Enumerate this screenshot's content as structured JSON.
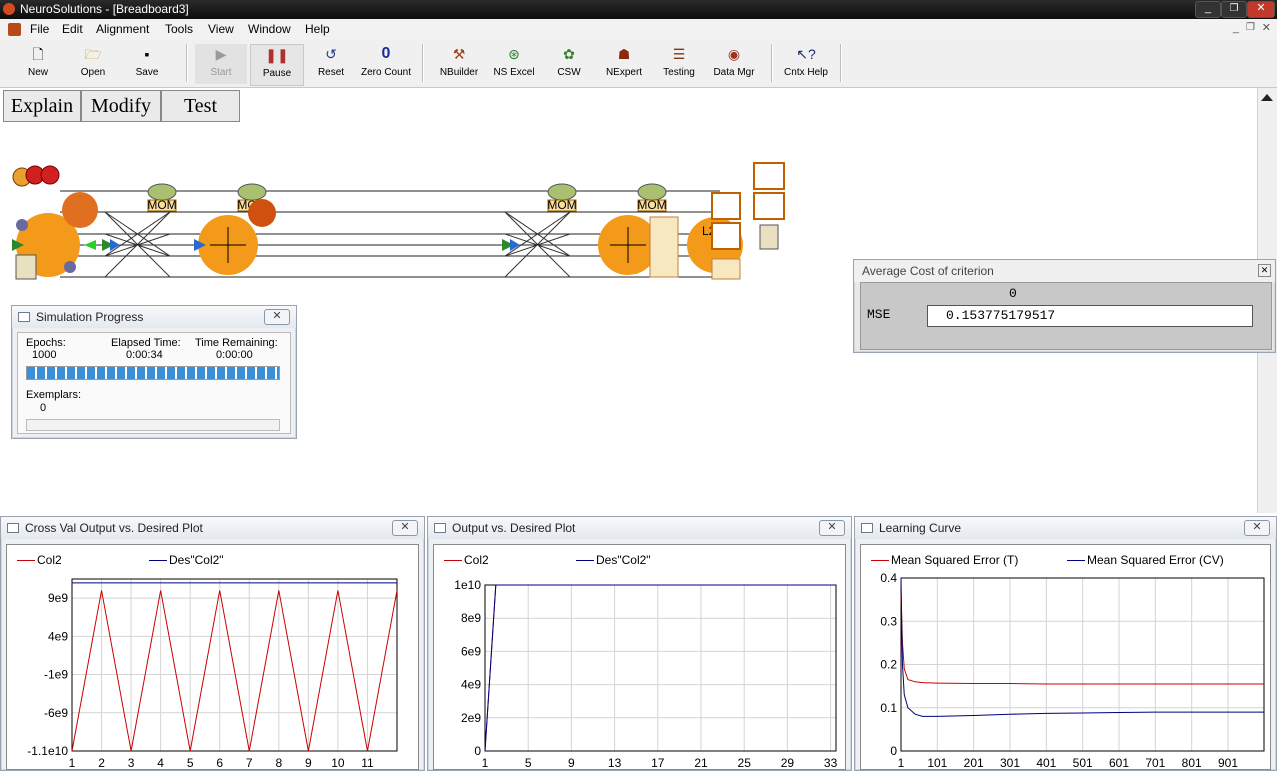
{
  "app": {
    "title": "NeuroSolutions - [Breadboard3]"
  },
  "menu": [
    "File",
    "Edit",
    "Alignment",
    "Tools",
    "View",
    "Window",
    "Help"
  ],
  "toolbar": [
    {
      "label": "New",
      "icon": "new-file-icon"
    },
    {
      "label": "Open",
      "icon": "open-folder-icon"
    },
    {
      "label": "Save",
      "icon": "save-disk-icon"
    },
    {
      "label": "Start",
      "icon": "play-icon"
    },
    {
      "label": "Pause",
      "icon": "pause-icon"
    },
    {
      "label": "Reset",
      "icon": "reset-icon"
    },
    {
      "label": "Zero Count",
      "icon": "zero-icon",
      "glyph": "0"
    },
    {
      "label": "NBuilder",
      "icon": "nbuilder-icon"
    },
    {
      "label": "NS Excel",
      "icon": "excel-icon"
    },
    {
      "label": "CSW",
      "icon": "csw-icon"
    },
    {
      "label": "NExpert",
      "icon": "nexpert-icon"
    },
    {
      "label": "Testing",
      "icon": "testing-icon"
    },
    {
      "label": "Data Mgr",
      "icon": "data-manager-icon"
    },
    {
      "label": "Cntx Help",
      "icon": "context-help-icon"
    }
  ],
  "nav_buttons": [
    "Explain",
    "Modify",
    "Test"
  ],
  "breadboard": {
    "mom_label": "MOM",
    "l2_label": "L2"
  },
  "sim_progress": {
    "title": "Simulation Progress",
    "epochs_label": "Epochs:",
    "epochs_value": "1000",
    "elapsed_label": "Elapsed Time:",
    "elapsed_value": "0:00:34",
    "remaining_label": "Time Remaining:",
    "remaining_value": "0:00:00",
    "epoch_progress": 1.0,
    "exemplars_label": "Exemplars:",
    "exemplars_value": "0",
    "exemplar_progress": 0.0
  },
  "avg_cost": {
    "title": "Average Cost of criterion",
    "column": "0",
    "row_label": "MSE",
    "value": "0.153775179517"
  },
  "plots": {
    "crossval": {
      "title": "Cross Val Output vs. Desired Plot"
    },
    "output": {
      "title": "Output vs. Desired Plot"
    },
    "learning": {
      "title": "Learning Curve"
    }
  },
  "colors": {
    "red_series": "#cc0000",
    "blue_series": "#000080",
    "progress_fill": "#3a8fd8"
  },
  "chart_data": [
    {
      "type": "line",
      "title": "Cross Val Output vs. Desired Plot",
      "x": [
        1,
        2,
        3,
        4,
        5,
        6,
        7,
        8,
        9,
        10,
        11,
        12
      ],
      "x_ticks": [
        "1",
        "2",
        "3",
        "4",
        "5",
        "6",
        "7",
        "8",
        "9",
        "10",
        "11"
      ],
      "y_ticks": [
        "9e9",
        "4e9",
        "-1e9",
        "-6e9",
        "-1.1e10"
      ],
      "y_tick_values": [
        9000000000.0,
        4000000000.0,
        -1000000000.0,
        -6000000000.0,
        -11000000000.0
      ],
      "ylim": [
        -11000000000.0,
        11500000000.0
      ],
      "xlim": [
        1,
        12
      ],
      "grid": true,
      "series": [
        {
          "name": "Col2",
          "color": "#cc0000",
          "values": [
            -11000000000.0,
            10000000000.0,
            -11000000000.0,
            10000000000.0,
            -11000000000.0,
            10000000000.0,
            -11000000000.0,
            10000000000.0,
            -11000000000.0,
            10000000000.0,
            -11000000000.0,
            10000000000.0
          ]
        },
        {
          "name": "Des\"Col2\"",
          "color": "#000080",
          "values": [
            11000000000.0,
            11000000000.0,
            11000000000.0,
            11000000000.0,
            11000000000.0,
            11000000000.0,
            11000000000.0,
            11000000000.0,
            11000000000.0,
            11000000000.0,
            11000000000.0,
            11000000000.0
          ]
        }
      ]
    },
    {
      "type": "line",
      "title": "Output vs. Desired Plot",
      "x": [
        1,
        2,
        33.5
      ],
      "x_ticks": [
        "1",
        "5",
        "9",
        "13",
        "17",
        "21",
        "25",
        "29",
        "33"
      ],
      "x_tick_values": [
        1,
        5,
        9,
        13,
        17,
        21,
        25,
        29,
        33
      ],
      "y_ticks": [
        "1e10",
        "8e9",
        "6e9",
        "4e9",
        "2e9",
        "0"
      ],
      "y_tick_values": [
        10000000000.0,
        8000000000.0,
        6000000000.0,
        4000000000.0,
        2000000000.0,
        0
      ],
      "ylim": [
        0,
        10000000000.0
      ],
      "xlim": [
        1,
        33.5
      ],
      "grid": true,
      "series": [
        {
          "name": "Col2",
          "color": "#cc0000",
          "values": [
            0,
            10000000000.0,
            10000000000.0
          ]
        },
        {
          "name": "Des\"Col2\"",
          "color": "#000080",
          "values": [
            0,
            10000000000.0,
            10000000000.0
          ]
        }
      ]
    },
    {
      "type": "line",
      "title": "Learning Curve",
      "x": [
        1,
        5,
        10,
        20,
        40,
        60,
        100,
        200,
        300,
        400,
        500,
        600,
        700,
        800,
        900,
        1000
      ],
      "x_ticks": [
        "1",
        "101",
        "201",
        "301",
        "401",
        "501",
        "601",
        "701",
        "801",
        "901"
      ],
      "x_tick_values": [
        1,
        101,
        201,
        301,
        401,
        501,
        601,
        701,
        801,
        901
      ],
      "y_ticks": [
        "0.4",
        "0.3",
        "0.2",
        "0.1",
        "0"
      ],
      "y_tick_values": [
        0.4,
        0.3,
        0.2,
        0.1,
        0
      ],
      "ylim": [
        0,
        0.4
      ],
      "xlim": [
        1,
        1000
      ],
      "grid": true,
      "series": [
        {
          "name": "Mean Squared Error (T)",
          "color": "#cc0000",
          "values": [
            0.36,
            0.25,
            0.19,
            0.165,
            0.16,
            0.158,
            0.157,
            0.156,
            0.156,
            0.155,
            0.155,
            0.155,
            0.155,
            0.155,
            0.155,
            0.155
          ]
        },
        {
          "name": "Mean Squared Error (CV)",
          "color": "#000080",
          "values": [
            0.4,
            0.2,
            0.13,
            0.1,
            0.085,
            0.08,
            0.08,
            0.082,
            0.085,
            0.087,
            0.088,
            0.089,
            0.09,
            0.09,
            0.09,
            0.09
          ]
        }
      ]
    }
  ]
}
